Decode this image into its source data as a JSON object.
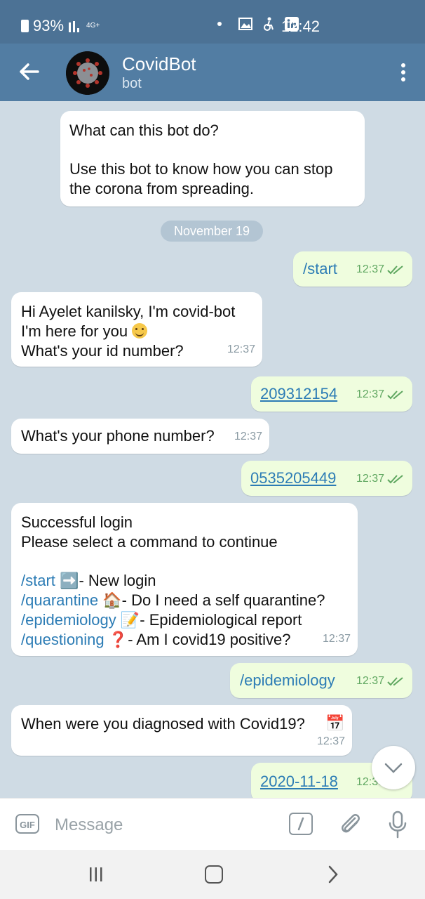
{
  "status": {
    "battery": "93%",
    "network": "4G+",
    "time": "12:42"
  },
  "header": {
    "title": "CovidBot",
    "subtitle": "bot"
  },
  "intro": {
    "heading": "What can this bot do?",
    "line1": "Use this bot to know how you can stop",
    "line2": "the corona from spreading."
  },
  "date_separator": "November 19",
  "messages": {
    "m1": {
      "text": "/start",
      "time": "12:37"
    },
    "m2": {
      "line1": "Hi Ayelet kanilsky, I'm covid-bot",
      "line2": "I'm here for you",
      "line3": "What's your id number?",
      "time": "12:37"
    },
    "m3": {
      "text": "209312154",
      "time": "12:37"
    },
    "m4": {
      "text": "What's your phone number?",
      "time": "12:37"
    },
    "m5": {
      "text": "0535205449",
      "time": "12:37"
    },
    "m6": {
      "line1": "Successful login",
      "line2": "Please select a command to continue",
      "commands": [
        {
          "cmd": "/start",
          "emoji": "➡️",
          "desc": "- New login"
        },
        {
          "cmd": "/quarantine",
          "emoji": "🏠",
          "desc": "- Do I need a self quarantine?"
        },
        {
          "cmd": "/epidemiology",
          "emoji": "📝",
          "desc": "- Epidemiological report"
        },
        {
          "cmd": "/questioning",
          "emoji": "❓",
          "desc": "- Am I covid19 positive?"
        }
      ],
      "time": "12:37"
    },
    "m7": {
      "text": "/epidemiology",
      "time": "12:37"
    },
    "m8": {
      "text": "When were you diagnosed with Covid19?",
      "emoji": "📅",
      "time": "12:37"
    },
    "m9": {
      "text": "2020-11-18",
      "time": "12:38"
    }
  },
  "input": {
    "gif_label": "GIF",
    "placeholder": "Message"
  },
  "colors": {
    "header": "#527da3",
    "statusbar": "#4c7295",
    "outgoing_bubble": "#effdde",
    "link": "#2c7cb5"
  }
}
